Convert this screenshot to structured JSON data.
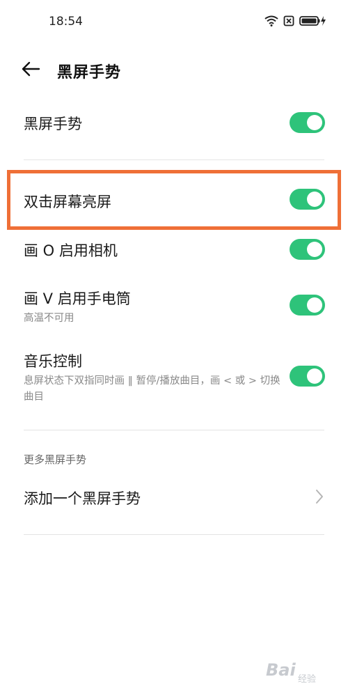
{
  "status_bar": {
    "time": "18:54",
    "icons": [
      "wifi-icon",
      "sim-off-icon",
      "battery-charging-icon"
    ]
  },
  "header": {
    "back_icon": "arrow-left-icon",
    "title": "黑屏手势"
  },
  "settings": [
    {
      "label": "黑屏手势",
      "enabled": true
    },
    {
      "label": "双击屏幕亮屏",
      "enabled": true,
      "highlighted": true
    },
    {
      "label": "画 O 启用相机",
      "enabled": true
    },
    {
      "label": "画 V 启用手电筒",
      "subtitle": "高温不可用",
      "enabled": true
    },
    {
      "label": "音乐控制",
      "subtitle": "息屏状态下双指同时画 ‖ 暂停/播放曲目，画 < 或 > 切换曲目",
      "enabled": true
    }
  ],
  "more_section": {
    "header": "更多黑屏手势",
    "add_label": "添加一个黑屏手势"
  },
  "colors": {
    "toggle_on": "#2ec37a",
    "highlight": "#ef6f37"
  },
  "watermark": {
    "brand": "Bai",
    "sub": "经验"
  }
}
